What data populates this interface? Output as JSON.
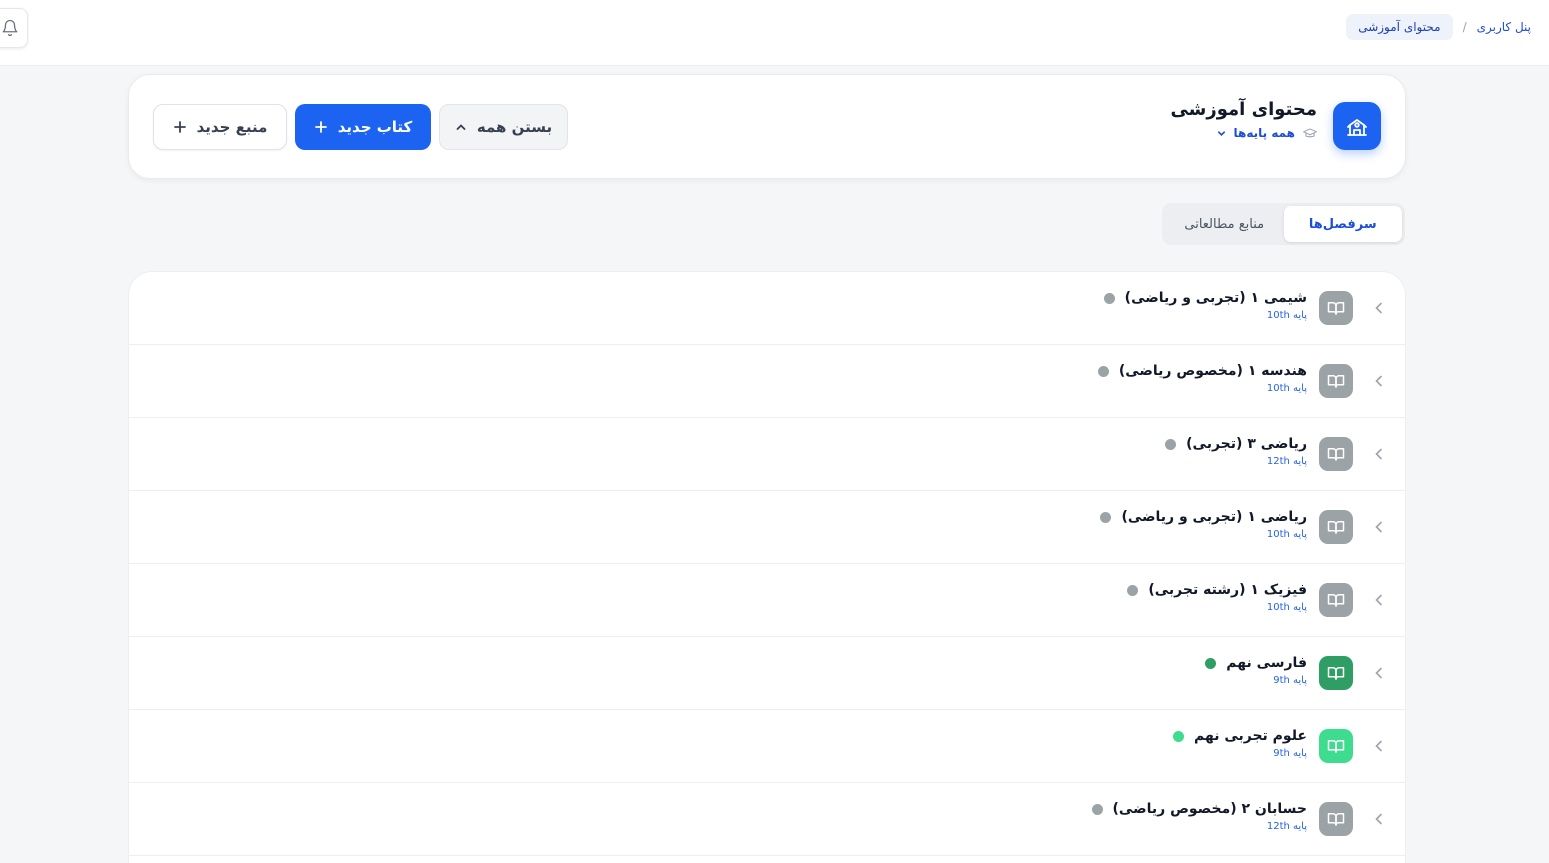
{
  "breadcrumb": {
    "home": "پنل کاربری",
    "separator": "/",
    "current": "محتوای آموزشی"
  },
  "header": {
    "title": "محتوای آموزشی",
    "grade_filter": "همه پایه‌ها",
    "logo_icon": "school-icon",
    "grade_icon": "graduation-cap-icon",
    "collapse_label": "بستن همه",
    "new_book_label": "کتاب جدید",
    "new_source_label": "منبع جدید"
  },
  "tabs": [
    {
      "label": "سرفصل‌ها",
      "active": true
    },
    {
      "label": "منابع مطالعاتی",
      "active": false
    }
  ],
  "colors": {
    "accent": "#1d63f2",
    "inactive": "#9ca3a6",
    "green_dark": "#2f9e64",
    "green_light": "#3ddc8f"
  },
  "books": [
    {
      "title": "شیمی ۱ (تجربی و ریاضی)",
      "grade": "پایه 10th",
      "status": "inactive"
    },
    {
      "title": "هندسه ۱ (مخصوص ریاضی)",
      "grade": "پایه 10th",
      "status": "inactive"
    },
    {
      "title": "ریاضی ۳ (تجربی)",
      "grade": "پایه 12th",
      "status": "inactive"
    },
    {
      "title": "ریاضی ۱ (تجربی و ریاضی)",
      "grade": "پایه 10th",
      "status": "inactive"
    },
    {
      "title": "فیزیک ۱ (رشته تجربی)",
      "grade": "پایه 10th",
      "status": "inactive"
    },
    {
      "title": "فارسی نهم",
      "grade": "پایه 9th",
      "status": "green_dark"
    },
    {
      "title": "علوم تجربی نهم",
      "grade": "پایه 9th",
      "status": "green_light"
    },
    {
      "title": "حسابان ۲ (مخصوص ریاضی)",
      "grade": "پایه 12th",
      "status": "inactive"
    }
  ]
}
